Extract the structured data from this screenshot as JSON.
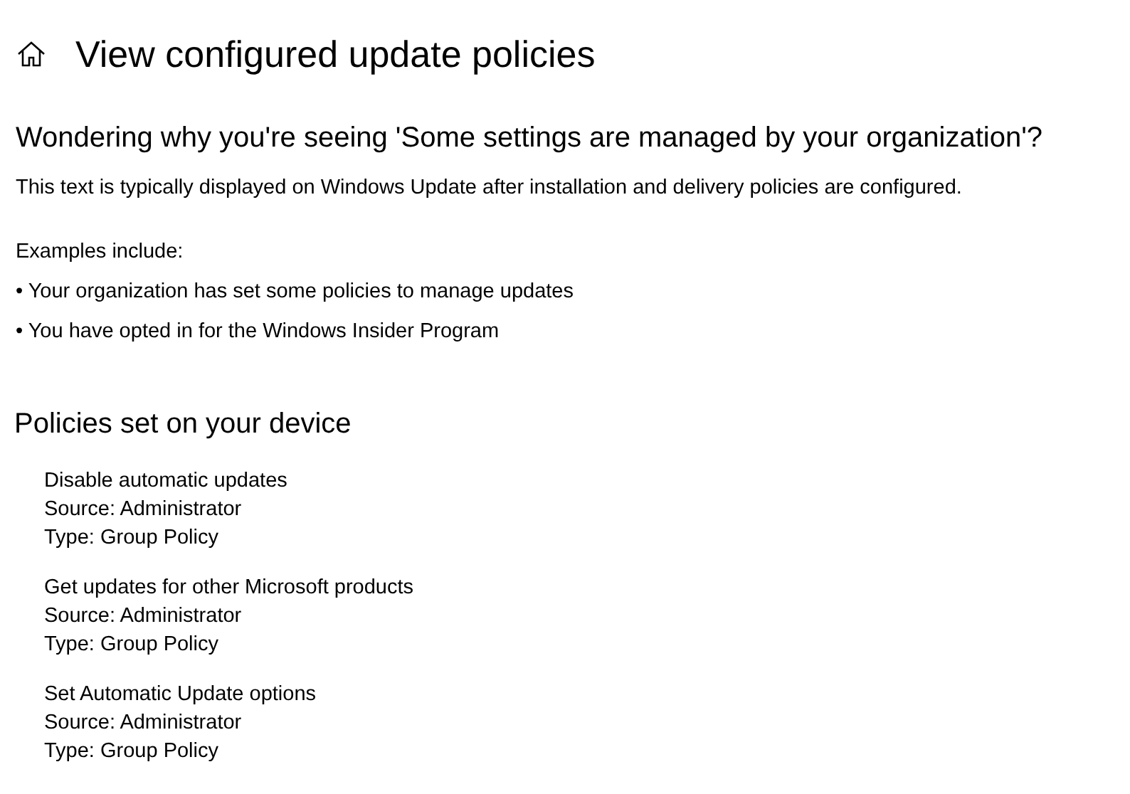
{
  "page": {
    "title": "View configured update policies"
  },
  "intro": {
    "heading": "Wondering why you're seeing 'Some settings are managed by your organization'?",
    "description": "This text is typically displayed on Windows Update after installation and delivery policies are configured.",
    "examples_label": "Examples include:",
    "examples": [
      "• Your organization has set some policies to manage updates",
      "• You have opted in for the Windows Insider Program"
    ]
  },
  "policies": {
    "heading": "Policies set on your device",
    "items": [
      {
        "name": "Disable automatic updates",
        "source": "Source: Administrator",
        "type": "Type: Group Policy"
      },
      {
        "name": "Get updates for other Microsoft products",
        "source": "Source: Administrator",
        "type": "Type: Group Policy"
      },
      {
        "name": "Set Automatic Update options",
        "source": "Source: Administrator",
        "type": "Type: Group Policy"
      }
    ]
  }
}
